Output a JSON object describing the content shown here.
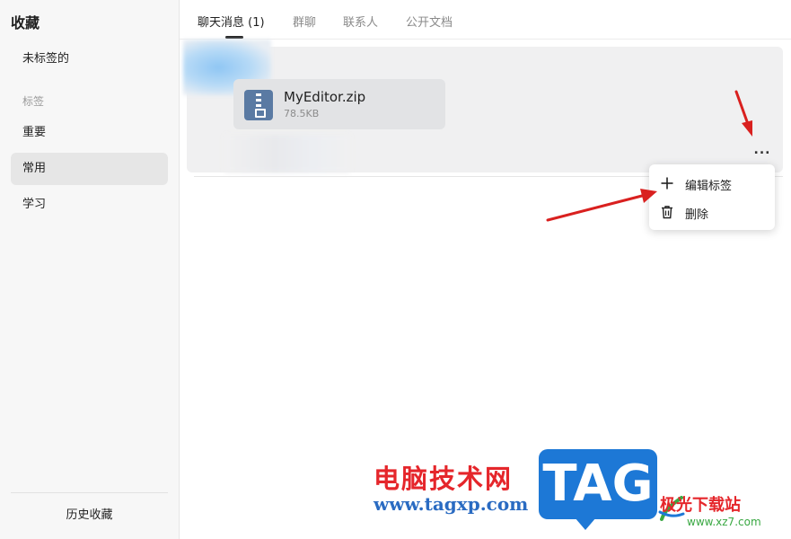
{
  "sidebar": {
    "title": "收藏",
    "untagged": "未标签的",
    "tags_header": "标签",
    "items": [
      {
        "label": "重要",
        "active": false
      },
      {
        "label": "常用",
        "active": true
      },
      {
        "label": "学习",
        "active": false
      }
    ],
    "history": "历史收藏"
  },
  "tabs": [
    {
      "label": "聊天消息 (1)",
      "active": true
    },
    {
      "label": "群聊",
      "active": false
    },
    {
      "label": "联系人",
      "active": false
    },
    {
      "label": "公开文档",
      "active": false
    }
  ],
  "message": {
    "file_name": "MyEditor.zip",
    "file_size": "78.5KB",
    "file_icon": "zip-file-icon",
    "more_label": "..."
  },
  "context_menu": {
    "items": [
      {
        "label": "编辑标签",
        "icon": "plus-icon"
      },
      {
        "label": "删除",
        "icon": "trash-icon"
      }
    ]
  },
  "watermark": {
    "brand_cn": "电脑技术网",
    "url": "www.tagxp.com",
    "tag": "TAG",
    "site_cn": "极光下载站",
    "site_url": "www.xz7.com"
  },
  "colors": {
    "annotation_arrow": "#d9201f",
    "zip_icon": "#5a7aa3",
    "watermark_red": "#e5262b",
    "watermark_blue": "#1d78d6"
  }
}
